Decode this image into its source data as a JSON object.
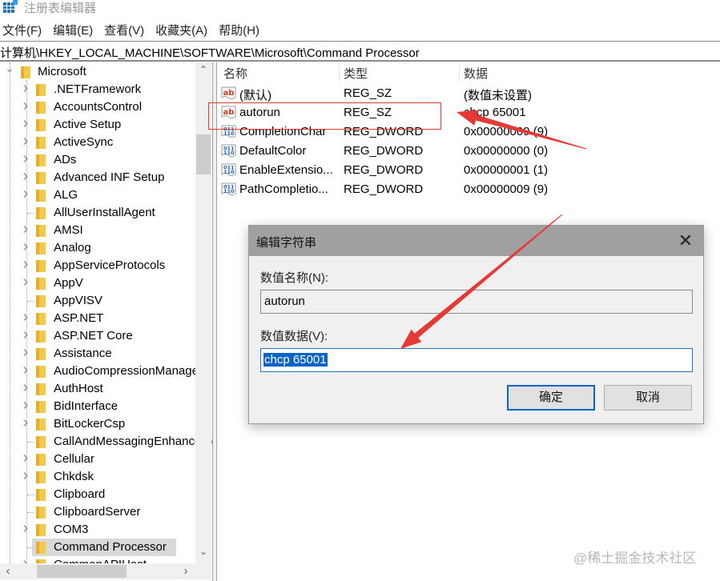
{
  "window": {
    "title": "注册表编辑器"
  },
  "menu": {
    "items": [
      "文件(F)",
      "编辑(E)",
      "查看(V)",
      "收藏夹(A)",
      "帮助(H)"
    ]
  },
  "address": {
    "path": "计算机\\HKEY_LOCAL_MACHINE\\SOFTWARE\\Microsoft\\Command Processor"
  },
  "tree": {
    "root": {
      "label": "Microsoft",
      "expanded": true
    },
    "items": [
      {
        "label": ".NETFramework",
        "has_children": true
      },
      {
        "label": "AccountsControl",
        "has_children": true
      },
      {
        "label": "Active Setup",
        "has_children": true
      },
      {
        "label": "ActiveSync",
        "has_children": true
      },
      {
        "label": "ADs",
        "has_children": true
      },
      {
        "label": "Advanced INF Setup",
        "has_children": true
      },
      {
        "label": "ALG",
        "has_children": true
      },
      {
        "label": "AllUserInstallAgent",
        "has_children": false
      },
      {
        "label": "AMSI",
        "has_children": true
      },
      {
        "label": "Analog",
        "has_children": true
      },
      {
        "label": "AppServiceProtocols",
        "has_children": true
      },
      {
        "label": "AppV",
        "has_children": true
      },
      {
        "label": "AppVISV",
        "has_children": false
      },
      {
        "label": "ASP.NET",
        "has_children": true
      },
      {
        "label": "ASP.NET Core",
        "has_children": true
      },
      {
        "label": "Assistance",
        "has_children": true
      },
      {
        "label": "AudioCompressionManager",
        "has_children": true
      },
      {
        "label": "AuthHost",
        "has_children": true
      },
      {
        "label": "BidInterface",
        "has_children": true
      },
      {
        "label": "BitLockerCsp",
        "has_children": true
      },
      {
        "label": "CallAndMessagingEnhancement",
        "has_children": false
      },
      {
        "label": "Cellular",
        "has_children": true
      },
      {
        "label": "Chkdsk",
        "has_children": true
      },
      {
        "label": "Clipboard",
        "has_children": false
      },
      {
        "label": "ClipboardServer",
        "has_children": false
      },
      {
        "label": "COM3",
        "has_children": true
      },
      {
        "label": "Command Processor",
        "has_children": false,
        "selected": true
      },
      {
        "label": "CommonAPIHost",
        "has_children": true
      }
    ]
  },
  "list": {
    "columns": [
      "名称",
      "类型",
      "数据"
    ],
    "rows": [
      {
        "icon": "string-value-icon",
        "name": "(默认)",
        "type": "REG_SZ",
        "data": "(数值未设置)"
      },
      {
        "icon": "string-value-icon",
        "name": "autorun",
        "type": "REG_SZ",
        "data": "chcp 65001"
      },
      {
        "icon": "binary-value-icon",
        "name": "CompletionChar",
        "type": "REG_DWORD",
        "data": "0x00000009 (9)"
      },
      {
        "icon": "binary-value-icon",
        "name": "DefaultColor",
        "type": "REG_DWORD",
        "data": "0x00000000 (0)"
      },
      {
        "icon": "binary-value-icon",
        "name": "EnableExtensio...",
        "type": "REG_DWORD",
        "data": "0x00000001 (1)"
      },
      {
        "icon": "binary-value-icon",
        "name": "PathCompletio...",
        "type": "REG_DWORD",
        "data": "0x00000009 (9)"
      }
    ]
  },
  "dialog": {
    "title": "编辑字符串",
    "name_label": "数值名称(N):",
    "name_value": "autorun",
    "data_label": "数值数据(V):",
    "data_value": "chcp 65001",
    "ok_label": "确定",
    "cancel_label": "取消"
  },
  "annotation": {
    "color": "#e53935"
  },
  "watermark": "@稀土掘金技术社区"
}
